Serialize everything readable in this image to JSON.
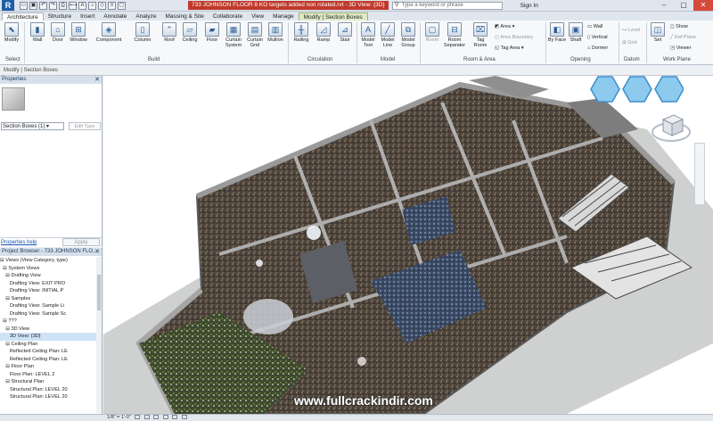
{
  "app": {
    "logo": "R",
    "doc_title": "733 JOHNSON FLOOR 8 KO targets added non rotated.rvt - 3D View: {3D}",
    "search_placeholder": "Type a keyword or phrase",
    "sign_in": "Sign In"
  },
  "tabs": [
    "Architecture",
    "Structure",
    "Insert",
    "Annotate",
    "Analyze",
    "Massing & Site",
    "Collaborate",
    "View",
    "Manage",
    "Modify | Section Boxes"
  ],
  "ribbon": {
    "modify": "Modify",
    "build": [
      "Wall",
      "Door",
      "Window",
      "Component",
      "Column",
      "Roof",
      "Ceiling",
      "Floor",
      "Curtain System",
      "Curtain Grid",
      "Mullion"
    ],
    "circulation": [
      "Railing",
      "Ramp",
      "Stair"
    ],
    "model": [
      "Model Text",
      "Model Line",
      "Model Group"
    ],
    "room_area": [
      "Room",
      "Room Separator",
      "Tag Room"
    ],
    "room_area_small": [
      "Area",
      "Area Boundary",
      "Tag Area"
    ],
    "opening": [
      "By Face",
      "Shaft"
    ],
    "opening_small": [
      "Wall",
      "Vertical",
      "Dormer"
    ],
    "datum": [
      "Level",
      "Grid"
    ],
    "work_plane": [
      "Set"
    ],
    "work_plane_small": [
      "Show",
      "Ref Plane",
      "Viewer"
    ],
    "panels": {
      "select": "Select",
      "build": "Build",
      "circulation": "Circulation",
      "model": "Model",
      "room_area": "Room & Area",
      "opening": "Opening",
      "datum": "Datum",
      "work_plane": "Work Plane"
    }
  },
  "options_bar": "Modify | Section Boxes",
  "properties": {
    "title": "Properties",
    "selector": "Section Boxes (1)",
    "edit_type": "Edit Type",
    "help": "Properties help",
    "apply": "Apply"
  },
  "project_browser": {
    "title": "Project Browser - 733 JOHNSON FLO...",
    "rows": [
      "⊟ Views (View Category, type)",
      "  ⊟ System Views",
      "    ⊟ Drafting View",
      "       Drafting View: EXIT PRO",
      "       Drafting View: INITIAL P",
      "    ⊟ Samples",
      "       Drafting View: Sample Li",
      "       Drafting View: Sample Sc",
      "  ⊟ ???",
      "    ⊟ 3D View",
      "       3D View: {3D}",
      "    ⊟ Ceiling Plan",
      "       Reflected Ceiling Plan: LE",
      "       Reflected Ceiling Plan: LE",
      "    ⊟ Floor Plan",
      "       Floor Plan: LEVEL 2",
      "    ⊟ Structural Plan",
      "       Structural Plan: LEVEL 20",
      "       Structural Plan: LEVEL 20"
    ],
    "selected_index": 10
  },
  "view_control": {
    "scale": "1/8\" = 1'-0\""
  },
  "watermark": "www.fullcrackindir.com",
  "colors": {
    "accent": "#1f5fa8",
    "title_highlight": "#c0392b",
    "context_tab": "#dfe9c6"
  }
}
